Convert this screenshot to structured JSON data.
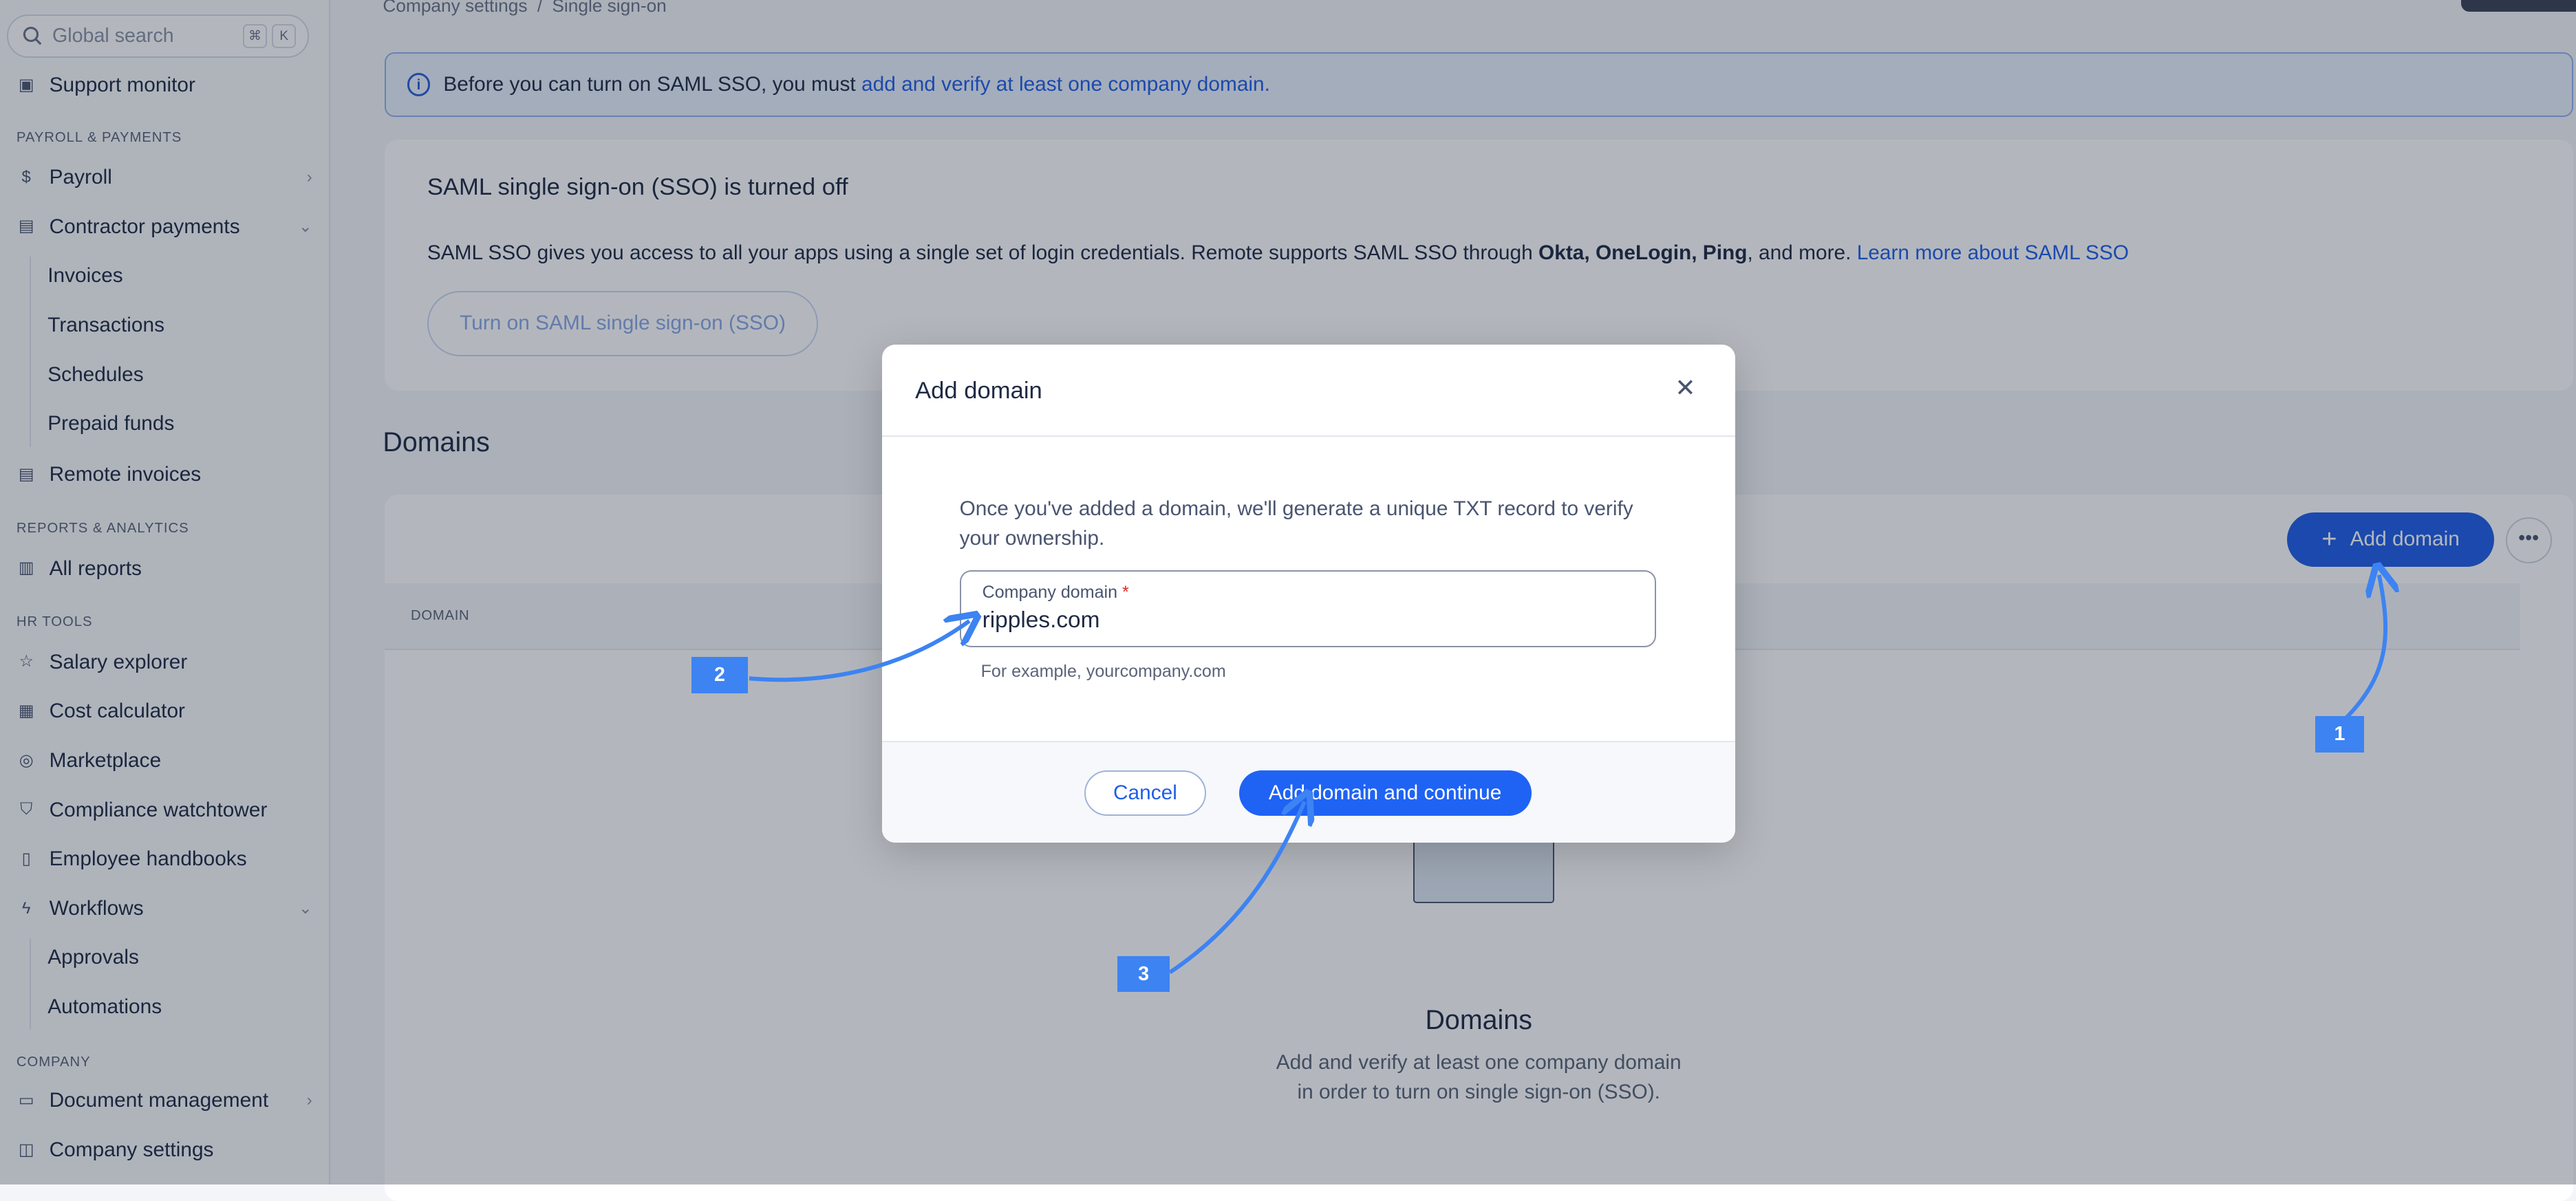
{
  "search": {
    "placeholder": "Global search",
    "kbd": [
      "⌘",
      "K"
    ]
  },
  "sidebar": {
    "top_item": "Support monitor",
    "sections": {
      "payroll": "PAYROLL & PAYMENTS",
      "reports": "REPORTS & ANALYTICS",
      "hr": "HR TOOLS",
      "company": "COMPANY"
    },
    "items": {
      "payroll": "Payroll",
      "contractor_payments": "Contractor payments",
      "invoices": "Invoices",
      "transactions": "Transactions",
      "schedules": "Schedules",
      "prepaid_funds": "Prepaid funds",
      "remote_invoices": "Remote invoices",
      "all_reports": "All reports",
      "salary_explorer": "Salary explorer",
      "cost_calculator": "Cost calculator",
      "marketplace": "Marketplace",
      "compliance_watchtower": "Compliance watchtower",
      "employee_handbooks": "Employee handbooks",
      "workflows": "Workflows",
      "approvals": "Approvals",
      "automations": "Automations",
      "document_management": "Document management",
      "company_settings": "Company settings"
    }
  },
  "breadcrumb": {
    "parent": "Company settings",
    "current": "Single sign-on"
  },
  "banner": {
    "text": "Before you can turn on SAML SSO, you must ",
    "link": "add and verify at least one company domain."
  },
  "sso": {
    "title": "SAML single sign-on (SSO) is turned off",
    "desc_prefix": "SAML SSO gives you access to all your apps using a single set of login credentials. Remote supports SAML SSO through ",
    "providers": "Okta, OneLogin, Ping",
    "desc_suffix": ", and more. ",
    "learn_more": "Learn more about SAML SSO",
    "button": "Turn on SAML single sign-on (SSO)"
  },
  "domains": {
    "heading": "Domains",
    "add_button": "Add domain",
    "column_header": "DOMAIN",
    "empty_title": "Domains",
    "empty_desc": "Add and verify at least one company domain in order to turn on single sign-on (SSO)."
  },
  "modal": {
    "title": "Add domain",
    "description": "Once you've added a domain, we'll generate a unique TXT record to verify your ownership.",
    "field_label": "Company domain",
    "field_required": "*",
    "field_value": "ripples.com",
    "field_hint": "For example, yourcompany.com",
    "cancel": "Cancel",
    "submit": "Add domain and continue"
  },
  "annotations": [
    "1",
    "2",
    "3"
  ],
  "colors": {
    "accent": "#1f5ee8",
    "annotation": "#3d83f2"
  }
}
